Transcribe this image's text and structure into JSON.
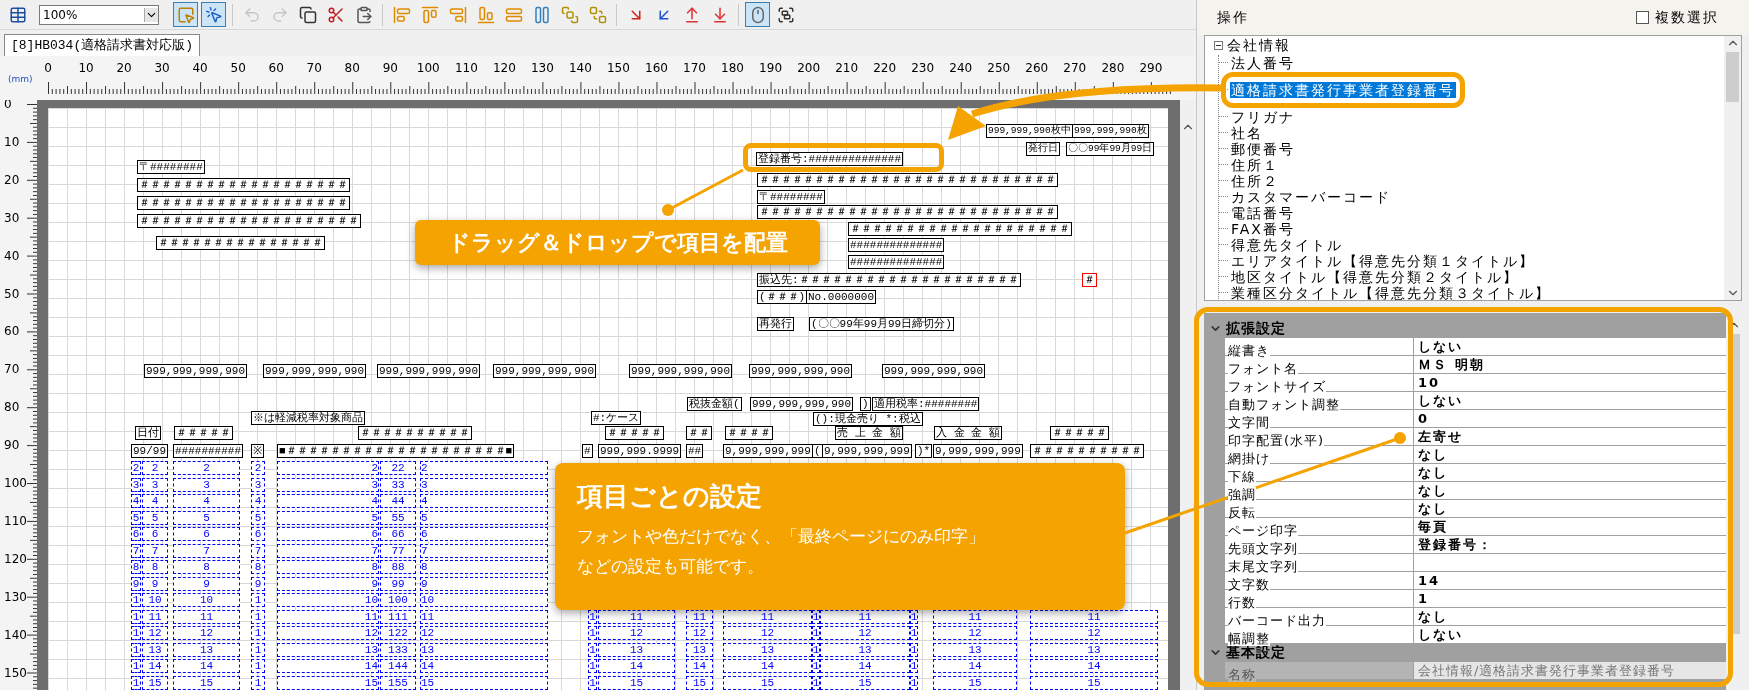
{
  "toolbar": {
    "zoom": "100%",
    "tools": [
      {
        "pressed": true,
        "disabled": false
      },
      {
        "pressed": true,
        "disabled": false
      },
      {
        "pressed": false,
        "disabled": true
      },
      {
        "pressed": false,
        "disabled": true
      },
      {
        "pressed": false,
        "disabled": false
      },
      {
        "pressed": false,
        "disabled": false
      },
      {
        "pressed": false,
        "disabled": false
      },
      {
        "pressed": false,
        "disabled": false
      },
      {
        "pressed": false,
        "disabled": false
      },
      {
        "pressed": false,
        "disabled": false
      },
      {
        "pressed": false,
        "disabled": false
      },
      {
        "pressed": false,
        "disabled": false
      },
      {
        "pressed": false,
        "disabled": false
      },
      {
        "pressed": false,
        "disabled": false
      },
      {
        "pressed": false,
        "disabled": false
      },
      {
        "pressed": false,
        "disabled": false
      },
      {
        "pressed": false,
        "disabled": false
      },
      {
        "pressed": false,
        "disabled": false
      },
      {
        "pressed": false,
        "disabled": false
      },
      {
        "pressed": true,
        "disabled": false
      },
      {
        "pressed": false,
        "disabled": false
      }
    ]
  },
  "document_tab": {
    "label": "[8]HB034(適格請求書対応版)",
    "selected": true
  },
  "ruler": {
    "unit": "(mm)",
    "x_labels": [
      "0",
      "10",
      "20",
      "30",
      "40",
      "50",
      "60",
      "70",
      "80",
      "90",
      "100",
      "110",
      "120",
      "130",
      "140",
      "150",
      "160",
      "170",
      "180",
      "190",
      "200",
      "210",
      "220",
      "230",
      "240",
      "250",
      "260",
      "270",
      "280",
      "290"
    ],
    "y_labels": [
      "0",
      "10",
      "20",
      "30",
      "40",
      "50",
      "60",
      "70",
      "80",
      "90",
      "100",
      "110",
      "120",
      "130",
      "140",
      "150"
    ]
  },
  "canvas": {
    "fields": [
      {
        "kind": "box",
        "text": "999,999,990枚中"
      },
      {
        "kind": "box",
        "text": "999,999,990枚"
      },
      {
        "kind": "box",
        "text": "発行日"
      },
      {
        "kind": "box",
        "text": "〇〇99年99月99日"
      },
      {
        "kind": "box",
        "text": "〒########"
      },
      {
        "kind": "box",
        "text": "＃＃＃＃＃＃＃＃＃＃＃＃＃＃＃＃＃＃＃"
      },
      {
        "kind": "box",
        "text": "＃＃＃＃＃＃＃＃＃＃＃＃＃＃＃＃＃＃＃"
      },
      {
        "kind": "box",
        "text": "＃＃＃＃＃＃＃＃＃＃＃＃＃＃＃＃＃＃＃＃"
      },
      {
        "kind": "box",
        "text": "＃＃＃＃＃＃＃＃＃＃＃＃＃＃＃"
      },
      {
        "kind": "box",
        "text": "登録番号:##############"
      },
      {
        "kind": "box",
        "text": "＃＃＃＃＃＃＃＃＃＃＃＃＃＃＃＃＃＃＃＃＃＃＃＃＃＃＃"
      },
      {
        "kind": "box",
        "text": "〒########"
      },
      {
        "kind": "box",
        "text": "＃＃＃＃＃＃＃＃＃＃＃＃＃＃＃＃＃＃＃＃＃＃＃＃＃＃＃"
      },
      {
        "kind": "box",
        "text": "＃＃＃＃＃＃＃＃＃＃＃＃＃＃＃＃＃＃＃＃"
      },
      {
        "kind": "box",
        "text": "##############"
      },
      {
        "kind": "box",
        "text": "##############"
      },
      {
        "kind": "box",
        "text": "振込先:＃＃＃＃＃＃＃＃＃＃＃＃＃＃＃＃＃＃＃＃"
      },
      {
        "kind": "flagged",
        "text": "＃"
      },
      {
        "kind": "box",
        "text": "(＃＃＃)"
      },
      {
        "kind": "box",
        "text": "No.0000000"
      },
      {
        "kind": "box",
        "text": "再発行"
      },
      {
        "kind": "box",
        "text": "(〇〇99年99月99日締切分)"
      },
      {
        "kind": "box",
        "text": "999,999,999,990"
      },
      {
        "kind": "box",
        "text": "999,999,999,990"
      },
      {
        "kind": "box",
        "text": "999,999,999,990"
      },
      {
        "kind": "box",
        "text": "999,999,999,990"
      },
      {
        "kind": "box",
        "text": "999,999,999,990"
      },
      {
        "kind": "box",
        "text": "999,999,999,990"
      },
      {
        "kind": "box",
        "text": "999,999,999,990"
      },
      {
        "kind": "box",
        "text": "税抜金額("
      },
      {
        "kind": "box",
        "text": "999,999,999,990"
      },
      {
        "kind": "box",
        "text": ")"
      },
      {
        "kind": "box",
        "text": "適用税率:########"
      },
      {
        "kind": "box",
        "text": "※は軽減税率対象商品"
      },
      {
        "kind": "box",
        "text": "#:ケース"
      },
      {
        "kind": "box",
        "text": "():現金売り *:税込"
      },
      {
        "kind": "box",
        "text": "日付"
      },
      {
        "kind": "box",
        "text": "＃＃＃＃＃"
      },
      {
        "kind": "box",
        "text": "＃＃＃＃＃＃＃＃＃＃"
      },
      {
        "kind": "box",
        "text": "＃＃＃＃＃"
      },
      {
        "kind": "box",
        "text": "＃＃"
      },
      {
        "kind": "box",
        "text": "＃＃＃＃"
      },
      {
        "kind": "box",
        "text": "売 上 金 額"
      },
      {
        "kind": "box",
        "text": "入 金 金 額"
      },
      {
        "kind": "box",
        "text": "＃＃＃＃＃"
      },
      {
        "kind": "box",
        "text": "99/99"
      },
      {
        "kind": "box",
        "text": "##########"
      },
      {
        "kind": "box",
        "text": "※"
      },
      {
        "kind": "box",
        "text": "■＃＃＃＃＃＃＃＃＃＃＃＃＃＃＃＃＃＃＃＃■"
      },
      {
        "kind": "box",
        "text": "#"
      },
      {
        "kind": "box",
        "text": "999,999.9999"
      },
      {
        "kind": "box",
        "text": "##"
      },
      {
        "kind": "box",
        "text": "9,999,999,999"
      },
      {
        "kind": "box",
        "text": "("
      },
      {
        "kind": "box",
        "text": "9,999,999,999"
      },
      {
        "kind": "box",
        "text": ")*"
      },
      {
        "kind": "box",
        "text": "9,999,999,999"
      },
      {
        "kind": "box",
        "text": "＃＃＃＃＃＃＃＃＃＃"
      }
    ],
    "detail_rows": [
      {
        "cells": [
          "2",
          "2",
          "2",
          "2",
          "2",
          "22",
          "2"
        ]
      },
      {
        "cells": [
          "3",
          "3",
          "3",
          "3",
          "3",
          "33",
          "3"
        ]
      },
      {
        "cells": [
          "4",
          "4",
          "4",
          "4",
          "4",
          "44",
          "4"
        ]
      },
      {
        "cells": [
          "5",
          "5",
          "5",
          "5",
          "5",
          "55",
          "5"
        ]
      },
      {
        "cells": [
          "6",
          "6",
          "6",
          "6",
          "6",
          "66",
          "6"
        ]
      },
      {
        "cells": [
          "7",
          "7",
          "7",
          "7",
          "7",
          "77",
          "7"
        ]
      },
      {
        "cells": [
          "8",
          "8",
          "8",
          "8",
          "8",
          "88",
          "8"
        ]
      },
      {
        "cells": [
          "9",
          "9",
          "9",
          "9",
          "9",
          "99",
          "9"
        ]
      },
      {
        "cells": [
          "1",
          "10",
          "10",
          "1",
          "10",
          "100",
          "10"
        ]
      },
      {
        "cells": [
          "1",
          "11",
          "11",
          "1",
          "11",
          "111",
          "11",
          "1",
          "11",
          "11",
          "11",
          "1",
          "11",
          "1",
          "11",
          "11"
        ]
      },
      {
        "cells": [
          "1",
          "12",
          "12",
          "1",
          "12",
          "122",
          "12",
          "1",
          "12",
          "12",
          "12",
          "1",
          "12",
          "1",
          "12",
          "12"
        ]
      },
      {
        "cells": [
          "1",
          "13",
          "13",
          "1",
          "13",
          "133",
          "13",
          "1",
          "13",
          "13",
          "13",
          "1",
          "13",
          "1",
          "13",
          "13"
        ]
      },
      {
        "cells": [
          "1",
          "14",
          "14",
          "1",
          "14",
          "144",
          "14",
          "1",
          "14",
          "14",
          "14",
          "1",
          "14",
          "1",
          "14",
          "14"
        ]
      },
      {
        "cells": [
          "1",
          "15",
          "15",
          "1",
          "15",
          "155",
          "15",
          "1",
          "15",
          "15",
          "15",
          "1",
          "15",
          "1",
          "15",
          "15"
        ]
      }
    ]
  },
  "drag_callout": {
    "text": "ドラッグ＆ドロップで項目を配置"
  },
  "settings_callout": {
    "title": "項目ごとの設定",
    "lines": [
      "フォントや色だけでなく、「最終ページにのみ印字」",
      "などの設定も可能です。"
    ]
  },
  "panel": {
    "title": "操作",
    "multi_select": {
      "label": "複数選択",
      "checked": false
    },
    "tree": {
      "label": "会社情報",
      "expanded": true,
      "children": [
        {
          "label": "法人番号",
          "selected": false
        },
        {
          "label": "適格請求書発行事業者登録番号",
          "selected": true
        },
        {
          "label": "フリガナ",
          "selected": false
        },
        {
          "label": "社名",
          "selected": false
        },
        {
          "label": "郵便番号",
          "selected": false
        },
        {
          "label": "住所１",
          "selected": false
        },
        {
          "label": "住所２",
          "selected": false
        },
        {
          "label": "カスタマーバーコード",
          "selected": false
        },
        {
          "label": "電話番号",
          "selected": false
        },
        {
          "label": "FAX番号",
          "selected": false
        },
        {
          "label": "得意先タイトル",
          "selected": false
        },
        {
          "label": "エリアタイトル【得意先分類１タイトル】",
          "selected": false
        },
        {
          "label": "地区タイトル【得意先分類２タイトル】",
          "selected": false
        },
        {
          "label": "業種区分タイトル【得意先分類３タイトル】",
          "selected": false
        }
      ]
    },
    "properties": [
      {
        "kind": "section",
        "label": "拡張設定",
        "expanded": true
      },
      {
        "kind": "property",
        "name": "縦書き",
        "value": "しない",
        "disabled": false
      },
      {
        "kind": "property",
        "name": "フォント名",
        "value": "ＭＳ 明朝",
        "disabled": false
      },
      {
        "kind": "property",
        "name": "フォントサイズ",
        "value": "10",
        "disabled": false
      },
      {
        "kind": "property",
        "name": "自動フォント調整",
        "value": "しない",
        "disabled": false
      },
      {
        "kind": "property",
        "name": "文字間",
        "value": "0",
        "disabled": false
      },
      {
        "kind": "property",
        "name": "印字配置(水平)",
        "value": "左寄せ",
        "disabled": false
      },
      {
        "kind": "property",
        "name": "網掛け",
        "value": "なし",
        "disabled": false
      },
      {
        "kind": "property",
        "name": "下線",
        "value": "なし",
        "disabled": false
      },
      {
        "kind": "property",
        "name": "強調",
        "value": "なし",
        "disabled": false
      },
      {
        "kind": "property",
        "name": "反転",
        "value": "なし",
        "disabled": false
      },
      {
        "kind": "property",
        "name": "ページ印字",
        "value": "毎頁",
        "disabled": false
      },
      {
        "kind": "property",
        "name": "先頭文字列",
        "value": "登録番号：",
        "disabled": false
      },
      {
        "kind": "property",
        "name": "末尾文字列",
        "disabled": false
      },
      {
        "kind": "property",
        "name": "文字数",
        "value": "14",
        "disabled": false
      },
      {
        "kind": "property",
        "name": "行数",
        "value": "1",
        "disabled": false
      },
      {
        "kind": "property",
        "name": "バーコード出力",
        "value": "なし",
        "disabled": false
      },
      {
        "kind": "property",
        "name": "幅調整",
        "value": "しない",
        "disabled": false
      },
      {
        "kind": "section",
        "label": "基本設定",
        "expanded": true
      },
      {
        "kind": "property",
        "name": "名称",
        "value": "会社情報/適格請求書発行事業者登録番号",
        "disabled": true
      }
    ]
  }
}
